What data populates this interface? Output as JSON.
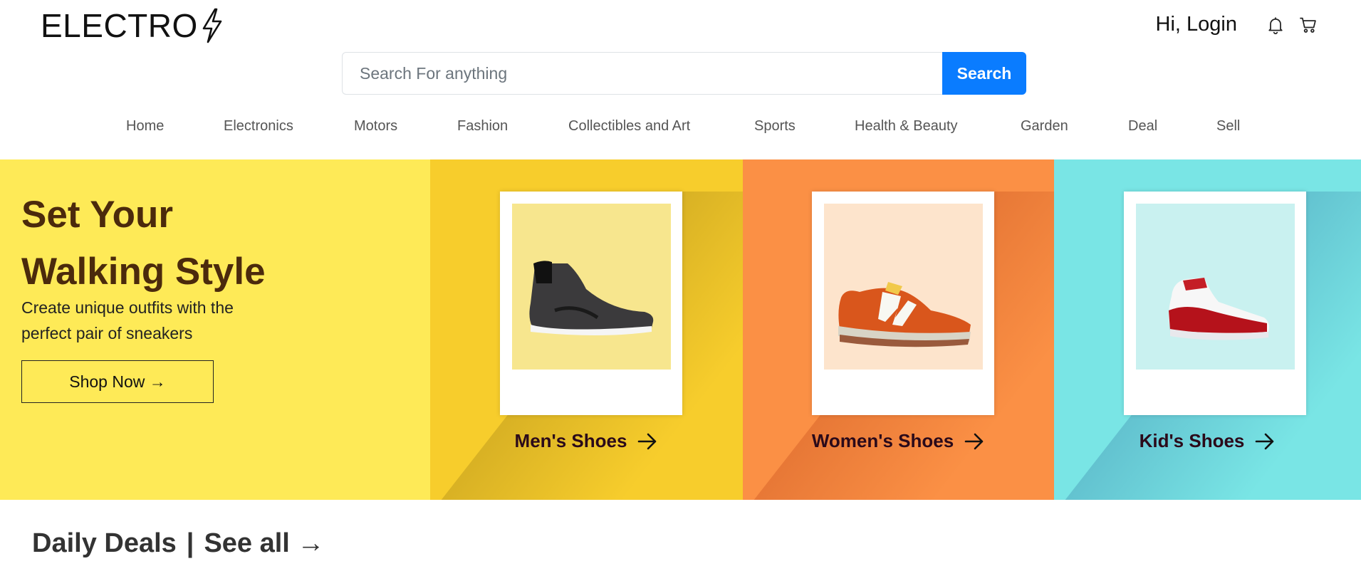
{
  "brand": {
    "name": "ELECTRO",
    "logo_icon": "lightning-bolt-icon"
  },
  "header": {
    "login_label": "Hi, Login",
    "icons": [
      "bell-icon",
      "cart-icon"
    ]
  },
  "search": {
    "placeholder": "Search For anything",
    "button_label": "Search"
  },
  "nav": {
    "items": [
      "Home",
      "Electronics",
      "Motors",
      "Fashion",
      "Collectibles and Art",
      "Sports",
      "Health & Beauty",
      "Garden",
      "Deal",
      "Sell"
    ]
  },
  "hero": {
    "title_line1": "Set Your",
    "title_line2": "Walking Style",
    "subtitle": "Create unique outfits with the perfect pair of sneakers",
    "cta_label": "Shop Now →",
    "panels": [
      {
        "label": "Men's Shoes",
        "bg": "#f7cd2c",
        "shadow": "#8a6a10",
        "img_bg": "#f7e68e"
      },
      {
        "label": "Women's Shoes",
        "bg": "#fb9045",
        "shadow": "#b53a10",
        "img_bg": "#fde4cc"
      },
      {
        "label": "Kid's Shoes",
        "bg": "#79e5e5",
        "shadow": "#2a6a9a",
        "img_bg": "#c9f1f0"
      }
    ]
  },
  "deals": {
    "title": "Daily Deals",
    "separator": "|",
    "see_all": "See all →"
  },
  "colors": {
    "primary": "#0a7cff",
    "hero_yellow": "#feea57",
    "hero_text": "#4b2a0c"
  }
}
